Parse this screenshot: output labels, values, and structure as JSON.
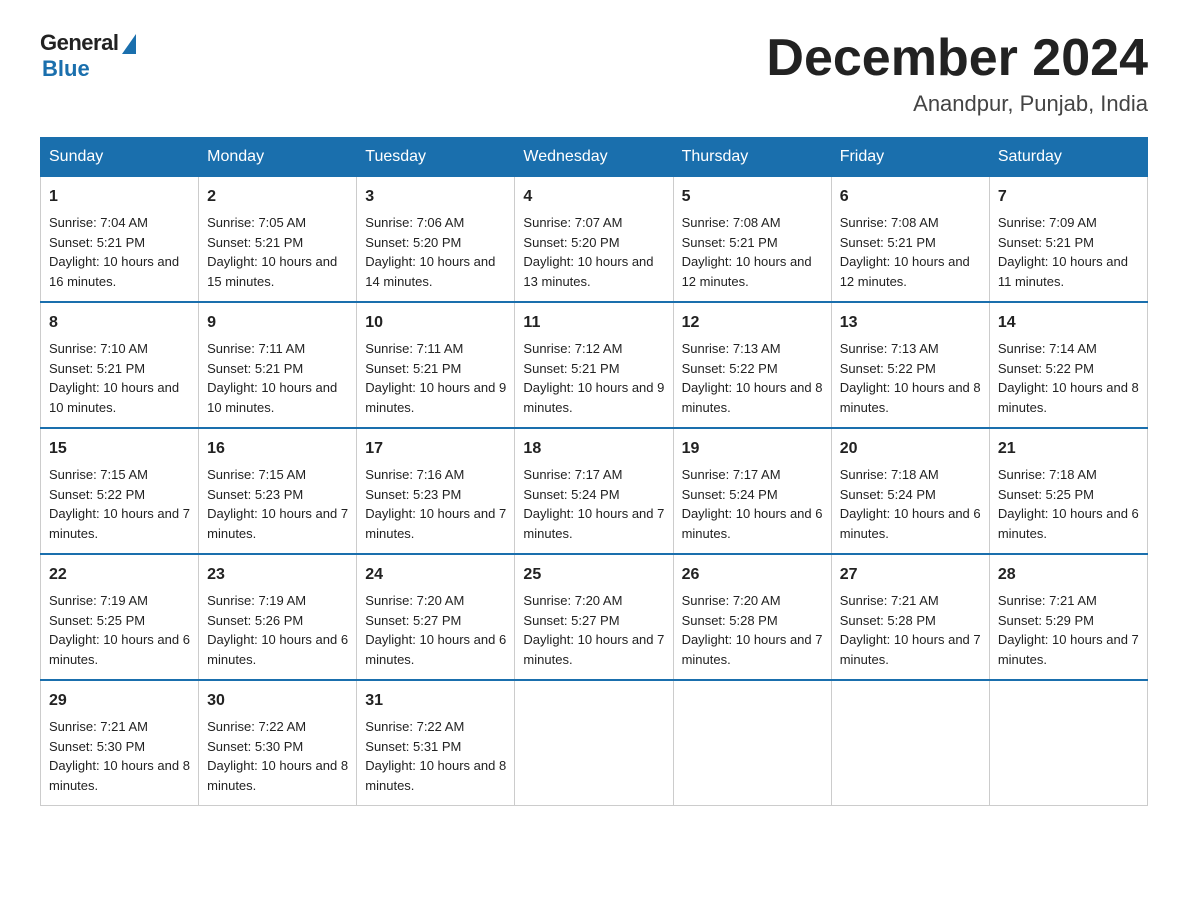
{
  "header": {
    "logo_general": "General",
    "logo_blue": "Blue",
    "month_title": "December 2024",
    "location": "Anandpur, Punjab, India"
  },
  "days_of_week": [
    "Sunday",
    "Monday",
    "Tuesday",
    "Wednesday",
    "Thursday",
    "Friday",
    "Saturday"
  ],
  "weeks": [
    [
      {
        "day": "1",
        "sunrise": "7:04 AM",
        "sunset": "5:21 PM",
        "daylight": "10 hours and 16 minutes."
      },
      {
        "day": "2",
        "sunrise": "7:05 AM",
        "sunset": "5:21 PM",
        "daylight": "10 hours and 15 minutes."
      },
      {
        "day": "3",
        "sunrise": "7:06 AM",
        "sunset": "5:20 PM",
        "daylight": "10 hours and 14 minutes."
      },
      {
        "day": "4",
        "sunrise": "7:07 AM",
        "sunset": "5:20 PM",
        "daylight": "10 hours and 13 minutes."
      },
      {
        "day": "5",
        "sunrise": "7:08 AM",
        "sunset": "5:21 PM",
        "daylight": "10 hours and 12 minutes."
      },
      {
        "day": "6",
        "sunrise": "7:08 AM",
        "sunset": "5:21 PM",
        "daylight": "10 hours and 12 minutes."
      },
      {
        "day": "7",
        "sunrise": "7:09 AM",
        "sunset": "5:21 PM",
        "daylight": "10 hours and 11 minutes."
      }
    ],
    [
      {
        "day": "8",
        "sunrise": "7:10 AM",
        "sunset": "5:21 PM",
        "daylight": "10 hours and 10 minutes."
      },
      {
        "day": "9",
        "sunrise": "7:11 AM",
        "sunset": "5:21 PM",
        "daylight": "10 hours and 10 minutes."
      },
      {
        "day": "10",
        "sunrise": "7:11 AM",
        "sunset": "5:21 PM",
        "daylight": "10 hours and 9 minutes."
      },
      {
        "day": "11",
        "sunrise": "7:12 AM",
        "sunset": "5:21 PM",
        "daylight": "10 hours and 9 minutes."
      },
      {
        "day": "12",
        "sunrise": "7:13 AM",
        "sunset": "5:22 PM",
        "daylight": "10 hours and 8 minutes."
      },
      {
        "day": "13",
        "sunrise": "7:13 AM",
        "sunset": "5:22 PM",
        "daylight": "10 hours and 8 minutes."
      },
      {
        "day": "14",
        "sunrise": "7:14 AM",
        "sunset": "5:22 PM",
        "daylight": "10 hours and 8 minutes."
      }
    ],
    [
      {
        "day": "15",
        "sunrise": "7:15 AM",
        "sunset": "5:22 PM",
        "daylight": "10 hours and 7 minutes."
      },
      {
        "day": "16",
        "sunrise": "7:15 AM",
        "sunset": "5:23 PM",
        "daylight": "10 hours and 7 minutes."
      },
      {
        "day": "17",
        "sunrise": "7:16 AM",
        "sunset": "5:23 PM",
        "daylight": "10 hours and 7 minutes."
      },
      {
        "day": "18",
        "sunrise": "7:17 AM",
        "sunset": "5:24 PM",
        "daylight": "10 hours and 7 minutes."
      },
      {
        "day": "19",
        "sunrise": "7:17 AM",
        "sunset": "5:24 PM",
        "daylight": "10 hours and 6 minutes."
      },
      {
        "day": "20",
        "sunrise": "7:18 AM",
        "sunset": "5:24 PM",
        "daylight": "10 hours and 6 minutes."
      },
      {
        "day": "21",
        "sunrise": "7:18 AM",
        "sunset": "5:25 PM",
        "daylight": "10 hours and 6 minutes."
      }
    ],
    [
      {
        "day": "22",
        "sunrise": "7:19 AM",
        "sunset": "5:25 PM",
        "daylight": "10 hours and 6 minutes."
      },
      {
        "day": "23",
        "sunrise": "7:19 AM",
        "sunset": "5:26 PM",
        "daylight": "10 hours and 6 minutes."
      },
      {
        "day": "24",
        "sunrise": "7:20 AM",
        "sunset": "5:27 PM",
        "daylight": "10 hours and 6 minutes."
      },
      {
        "day": "25",
        "sunrise": "7:20 AM",
        "sunset": "5:27 PM",
        "daylight": "10 hours and 7 minutes."
      },
      {
        "day": "26",
        "sunrise": "7:20 AM",
        "sunset": "5:28 PM",
        "daylight": "10 hours and 7 minutes."
      },
      {
        "day": "27",
        "sunrise": "7:21 AM",
        "sunset": "5:28 PM",
        "daylight": "10 hours and 7 minutes."
      },
      {
        "day": "28",
        "sunrise": "7:21 AM",
        "sunset": "5:29 PM",
        "daylight": "10 hours and 7 minutes."
      }
    ],
    [
      {
        "day": "29",
        "sunrise": "7:21 AM",
        "sunset": "5:30 PM",
        "daylight": "10 hours and 8 minutes."
      },
      {
        "day": "30",
        "sunrise": "7:22 AM",
        "sunset": "5:30 PM",
        "daylight": "10 hours and 8 minutes."
      },
      {
        "day": "31",
        "sunrise": "7:22 AM",
        "sunset": "5:31 PM",
        "daylight": "10 hours and 8 minutes."
      },
      null,
      null,
      null,
      null
    ]
  ]
}
